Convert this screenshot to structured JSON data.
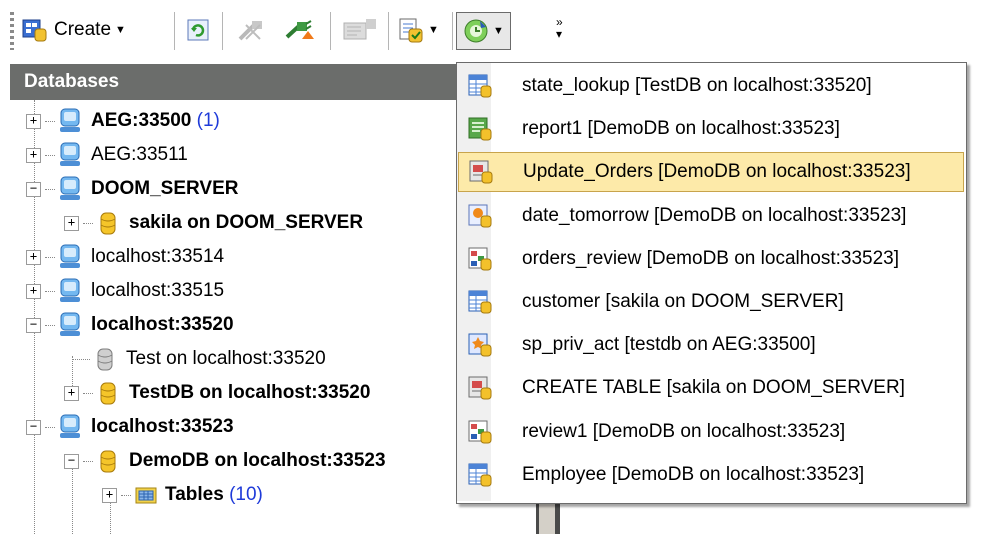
{
  "toolbar": {
    "create_label": "Create"
  },
  "panel": {
    "header": "Databases"
  },
  "tree": [
    {
      "label": "AEG:33500",
      "count": "(1)",
      "bold": true,
      "icon": "server-icon"
    },
    {
      "label": "AEG:33511",
      "bold": false,
      "icon": "server-icon"
    },
    {
      "label": "DOOM_SERVER",
      "bold": true,
      "icon": "server-icon"
    },
    {
      "label": "sakila on DOOM_SERVER",
      "bold": true,
      "icon": "database-icon"
    },
    {
      "label": "localhost:33514",
      "bold": false,
      "icon": "server-icon"
    },
    {
      "label": "localhost:33515",
      "bold": false,
      "icon": "server-icon"
    },
    {
      "label": "localhost:33520",
      "bold": true,
      "icon": "server-icon"
    },
    {
      "label": "Test on localhost:33520",
      "bold": false,
      "icon": "database-gray-icon"
    },
    {
      "label": "TestDB on localhost:33520",
      "bold": true,
      "icon": "database-icon"
    },
    {
      "label": "localhost:33523",
      "bold": true,
      "icon": "server-icon"
    },
    {
      "label": "DemoDB on localhost:33523",
      "bold": true,
      "icon": "database-icon"
    },
    {
      "label": "Tables",
      "count": "(10)",
      "bold": true,
      "icon": "tables-folder-icon"
    }
  ],
  "menu": {
    "highlighted_index": 2,
    "items": [
      {
        "label": "state_lookup [TestDB on localhost:33520]",
        "icon": "table-icon"
      },
      {
        "label": "report1 [DemoDB on localhost:33523]",
        "icon": "report-icon"
      },
      {
        "label": "Update_Orders [DemoDB on localhost:33523]",
        "icon": "sql-editor-icon"
      },
      {
        "label": "date_tomorrow [DemoDB on localhost:33523]",
        "icon": "function-icon"
      },
      {
        "label": "orders_review [DemoDB on localhost:33523]",
        "icon": "query-builder-icon"
      },
      {
        "label": "customer [sakila on DOOM_SERVER]",
        "icon": "table-icon"
      },
      {
        "label": "sp_priv_act [testdb on AEG:33500]",
        "icon": "procedure-icon"
      },
      {
        "label": "CREATE TABLE [sakila on DOOM_SERVER]",
        "icon": "sql-editor-icon"
      },
      {
        "label": "review1 [DemoDB on localhost:33523]",
        "icon": "query-builder-icon"
      },
      {
        "label": "Employee [DemoDB on localhost:33523]",
        "icon": "table-icon"
      }
    ]
  },
  "colors": {
    "header_bg": "#6b6d6b",
    "highlight_bg": "#fdeaa9",
    "count_blue": "#1f3bd9"
  }
}
